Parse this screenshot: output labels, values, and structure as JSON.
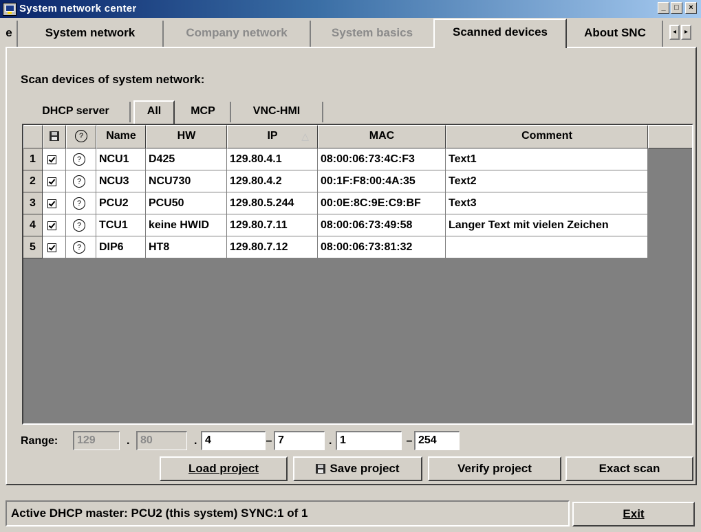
{
  "window": {
    "title": "System network center",
    "minimize": "_",
    "maximize": "□",
    "close": "×"
  },
  "tabs": [
    {
      "label": "e"
    },
    {
      "label": "System network"
    },
    {
      "label": "Company network"
    },
    {
      "label": "System basics"
    },
    {
      "label": "Scanned devices"
    },
    {
      "label": "About SNC"
    }
  ],
  "tab_scroll": {
    "left": "◂",
    "right": "▸"
  },
  "panel": {
    "heading": "Scan devices of system network:",
    "subtabs": [
      {
        "label": "DHCP server"
      },
      {
        "label": "All"
      },
      {
        "label": "MCP"
      },
      {
        "label": "VNC-HMI"
      }
    ]
  },
  "table": {
    "columns": [
      "",
      "",
      "Name",
      "HW",
      "IP",
      "MAC",
      "Comment"
    ],
    "sort_indicator": "△",
    "help_glyph": "?",
    "rows": [
      {
        "num": "1",
        "checked": true,
        "name": "NCU1",
        "hw": "D425",
        "ip": "129.80.4.1",
        "mac": "08:00:06:73:4C:F3",
        "comment": "Text1"
      },
      {
        "num": "2",
        "checked": true,
        "name": "NCU3",
        "hw": "NCU730",
        "ip": "129.80.4.2",
        "mac": "00:1F:F8:00:4A:35",
        "comment": "Text2"
      },
      {
        "num": "3",
        "checked": true,
        "name": "PCU2",
        "hw": "PCU50",
        "ip": "129.80.5.244",
        "mac": "00:0E:8C:9E:C9:BF",
        "comment": "Text3"
      },
      {
        "num": "4",
        "checked": true,
        "name": "TCU1",
        "hw": "keine HWID",
        "ip": "129.80.7.11",
        "mac": "08:00:06:73:49:58",
        "comment": "Langer Text mit vielen Zeichen"
      },
      {
        "num": "5",
        "checked": true,
        "name": "DIP6",
        "hw": "HT8",
        "ip": "129.80.7.12",
        "mac": "08:00:06:73:81:32",
        "comment": ""
      }
    ]
  },
  "range": {
    "label": "Range:",
    "octet1": "129",
    "octet2": "80",
    "octet3_from": "4",
    "octet3_to": "7",
    "octet4_from": "1",
    "octet4_to": "254",
    "dot": ".",
    "dash": "–"
  },
  "buttons": {
    "load_project": "Load project",
    "save_project": "Save project",
    "verify_project": "Verify project",
    "exact_scan": "Exact scan",
    "exit": "Exit"
  },
  "status": {
    "text": "Active DHCP master: PCU2 (this system) SYNC:1 of 1"
  },
  "colors": {
    "titlebar_start": "#0a246a",
    "titlebar_end": "#a6caf0",
    "face": "#d4d0c8",
    "disabled_text": "#8a8a8a"
  }
}
